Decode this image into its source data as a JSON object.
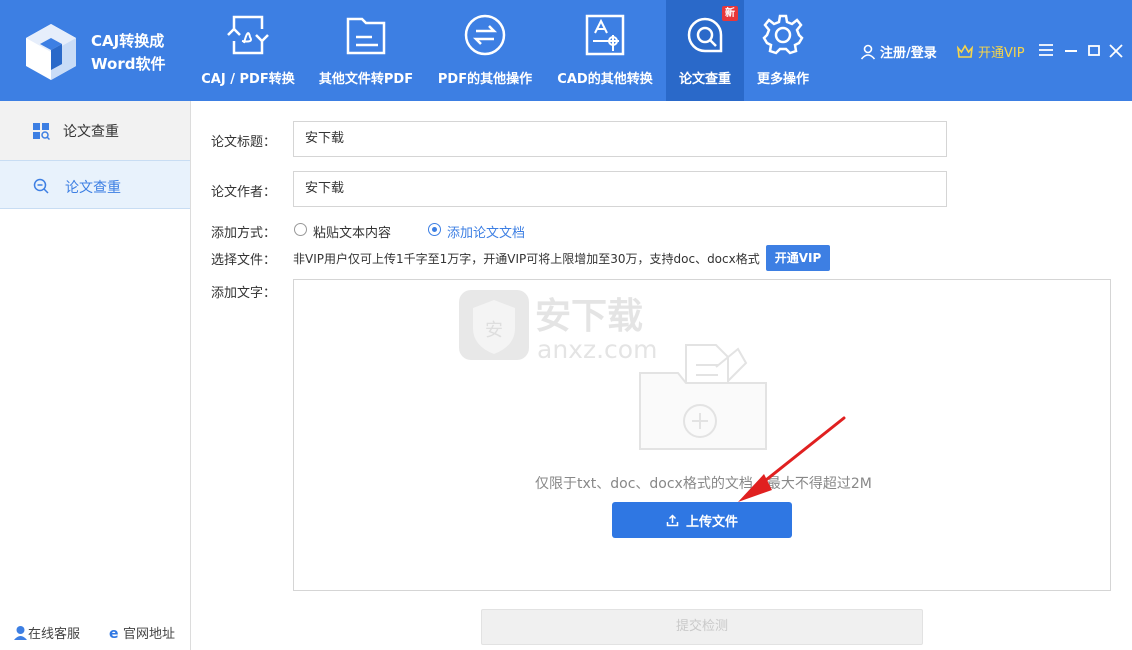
{
  "app": {
    "title_line1": "CAJ转换成",
    "title_line2": "Word软件"
  },
  "nav": [
    {
      "label": "CAJ / PDF转换"
    },
    {
      "label": "其他文件转PDF"
    },
    {
      "label": "PDF的其他操作"
    },
    {
      "label": "CAD的其他转换"
    },
    {
      "label": "论文查重",
      "badge": "新"
    },
    {
      "label": "更多操作"
    }
  ],
  "header": {
    "login": "注册/登录",
    "vip": "开通VIP"
  },
  "sidebar": {
    "head_label": "论文查重",
    "item_label": "论文查重",
    "footer_service": "在线客服",
    "footer_site": "官网地址"
  },
  "form": {
    "title_label": "论文标题：",
    "title_value": "安下载",
    "author_label": "论文作者：",
    "author_value": "安下载",
    "method_label": "添加方式：",
    "option_paste": "粘贴文本内容",
    "option_doc": "添加论文文档",
    "file_label": "选择文件：",
    "file_hint": "非VIP用户仅可上传1千字至1万字，开通VIP可将上限增加至30万，支持doc、docx格式",
    "vip_button": "开通VIP",
    "text_label": "添加文字：",
    "drop_tip": "仅限于txt、doc、docx格式的文档，最大不得超过2M",
    "upload_button": "上传文件",
    "submit_button": "提交检测"
  },
  "watermark": {
    "cn": "安下载",
    "en": "anxz.com"
  },
  "colors": {
    "primary": "#3d7fe3",
    "nav_active": "#2a69c9",
    "vip_gold": "#f7d54a",
    "badge_red": "#e8373a",
    "arrow_red": "#e02020"
  }
}
